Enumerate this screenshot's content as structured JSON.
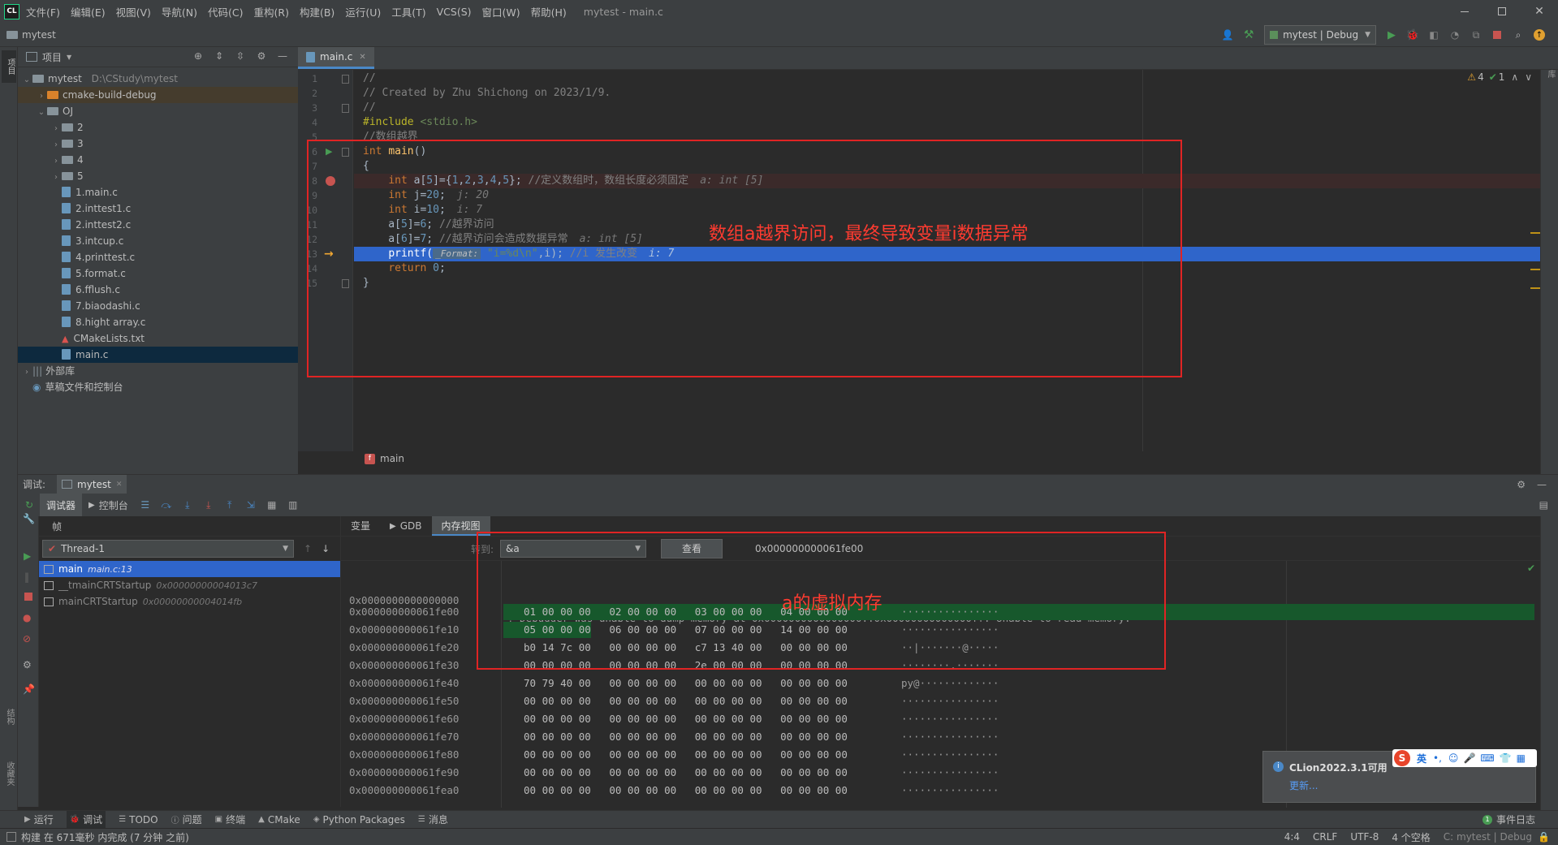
{
  "title_bar": {
    "app_logo": "CL",
    "menu": [
      "文件(F)",
      "编辑(E)",
      "视图(V)",
      "导航(N)",
      "代码(C)",
      "重构(R)",
      "构建(B)",
      "运行(U)",
      "工具(T)",
      "VCS(S)",
      "窗口(W)",
      "帮助(H)"
    ],
    "window_title": "mytest - main.c"
  },
  "nav_bar": {
    "project": "mytest",
    "run_config": "mytest | Debug"
  },
  "project_panel": {
    "title": "项目",
    "root": {
      "name": "mytest",
      "path": "D:\\CStudy\\mytest"
    },
    "items": [
      {
        "label": "cmake-build-debug",
        "kind": "folder-orange",
        "indent": 1,
        "expand": "›"
      },
      {
        "label": "OJ",
        "kind": "folder",
        "indent": 1,
        "expand": "⌄"
      },
      {
        "label": "2",
        "kind": "folder",
        "indent": 2,
        "expand": "›"
      },
      {
        "label": "3",
        "kind": "folder",
        "indent": 2,
        "expand": "›"
      },
      {
        "label": "4",
        "kind": "folder",
        "indent": 2,
        "expand": "›"
      },
      {
        "label": "5",
        "kind": "folder",
        "indent": 2,
        "expand": "›"
      },
      {
        "label": "1.main.c",
        "kind": "file",
        "indent": 2,
        "expand": ""
      },
      {
        "label": "2.inttest1.c",
        "kind": "file",
        "indent": 2,
        "expand": ""
      },
      {
        "label": "2.inttest2.c",
        "kind": "file",
        "indent": 2,
        "expand": ""
      },
      {
        "label": "3.intcup.c",
        "kind": "file",
        "indent": 2,
        "expand": ""
      },
      {
        "label": "4.printtest.c",
        "kind": "file",
        "indent": 2,
        "expand": ""
      },
      {
        "label": "5.format.c",
        "kind": "file",
        "indent": 2,
        "expand": ""
      },
      {
        "label": "6.fflush.c",
        "kind": "file",
        "indent": 2,
        "expand": ""
      },
      {
        "label": "7.biaodashi.c",
        "kind": "file",
        "indent": 2,
        "expand": ""
      },
      {
        "label": "8.hight array.c",
        "kind": "file",
        "indent": 2,
        "expand": ""
      },
      {
        "label": "CMakeLists.txt",
        "kind": "cmake",
        "indent": 2,
        "expand": ""
      },
      {
        "label": "main.c",
        "kind": "file",
        "indent": 2,
        "expand": "",
        "selected": true
      }
    ],
    "external_libs": "外部库",
    "scratches": "草稿文件和控制台"
  },
  "editor": {
    "tab": "main.c",
    "inspection": {
      "warnings": "4",
      "ok": "1"
    },
    "breadcrumb": "main",
    "lines": [
      {
        "n": "1",
        "html": "<span class='cmt'>//</span>"
      },
      {
        "n": "2",
        "html": "<span class='cmt'>// Created by Zhu Shichong on 2023/1/9.</span>"
      },
      {
        "n": "3",
        "html": "<span class='cmt'>//</span>"
      },
      {
        "n": "4",
        "html": "<span class='macro'>#include</span> <span class='str'>&lt;stdio.h&gt;</span>"
      },
      {
        "n": "5",
        "html": "<span class='cmt'>//数组越界</span>"
      },
      {
        "n": "6",
        "html": "<span class='kw'>int</span> <span class='fn'>main</span>()"
      },
      {
        "n": "7",
        "html": "{"
      },
      {
        "n": "8",
        "html": "    <span class='kw'>int</span> a[<span class='num'>5</span>]={<span class='num'>1</span>,<span class='num'>2</span>,<span class='num'>3</span>,<span class='num'>4</span>,<span class='num'>5</span>}; <span class='cmt'>//定义数组时，数组长度必须固定</span><span class='inl'>a: int [5]</span>"
      },
      {
        "n": "9",
        "html": "    <span class='kw'>int</span> j=<span class='num'>20</span>;<span class='inl'>j: 20</span>"
      },
      {
        "n": "10",
        "html": "    <span class='kw'>int</span> i=<span class='num'>10</span>;<span class='inl'>i: 7</span>"
      },
      {
        "n": "11",
        "html": "    a[<span class='num'>5</span>]=<span class='num'>6</span>; <span class='cmt'>//越界访问</span>"
      },
      {
        "n": "12",
        "html": "    a[<span class='num'>6</span>]=<span class='num'>7</span>; <span class='cmt'>//越界访问会造成数据异常</span><span class='inl'>a: int [5]</span>"
      },
      {
        "n": "13",
        "html": "    <span style='color:#ffffff'>printf(</span><span style='background:#4a6a8a;color:#c0c0c0;font-size:11px;padding:0 3px;font-style:italic'>_Format:</span> <span class='str'>\"i=%d\\n\"</span>,i); <span class='cmt'>//i 发生改变</span><span class='inl' style='color:#b0c4de'>i: 7</span>"
      },
      {
        "n": "14",
        "html": "    <span class='kw'>return</span> <span class='num'>0</span>;"
      },
      {
        "n": "15",
        "html": "}"
      }
    ],
    "annotation": "数组a越界访问，最终导致变量i数据异常"
  },
  "debug_panel": {
    "label": "调试:",
    "session_tab": "mytest",
    "tabs": [
      "调试器",
      "控制台"
    ],
    "frames_label": "帧",
    "thread": "Thread-1",
    "frames": [
      {
        "fn": "main",
        "loc": "main.c:13",
        "selected": true
      },
      {
        "fn": "__tmainCRTStartup",
        "loc": "0x00000000004013c7",
        "selected": false
      },
      {
        "fn": "mainCRTStartup",
        "loc": "0x00000000004014fb",
        "selected": false
      }
    ],
    "view_tabs": [
      "变量",
      "GDB",
      "内存视图"
    ],
    "goto_label": "转到:",
    "goto_value": "&a",
    "view_button": "查看",
    "current_address": "0x000000000061fe00",
    "error_row": {
      "addr": "0x0000000000000000",
      "msg": "! Debugger was unable to dump memory at 0x0000000000000000..0x00000000000000ff: Unable to read memory."
    },
    "annotation": "a的虚拟内存",
    "memory_rows": [
      {
        "addr": "0x000000000061fe00",
        "bytes": "01 00 00 00   02 00 00 00   03 00 00 00   04 00 00 00",
        "ascii": "················",
        "highlight": true
      },
      {
        "addr": "0x000000000061fe10",
        "bytes": "05 00 00 00   06 00 00 00   07 00 00 00   14 00 00 00",
        "ascii": "················",
        "highlight": "partial"
      },
      {
        "addr": "0x000000000061fe20",
        "bytes": "b0 14 7c 00   00 00 00 00   c7 13 40 00   00 00 00 00",
        "ascii": "··|·······@·····",
        "highlight": false
      },
      {
        "addr": "0x000000000061fe30",
        "bytes": "00 00 00 00   00 00 00 00   2e 00 00 00   00 00 00 00",
        "ascii": "········.·······",
        "highlight": false
      },
      {
        "addr": "0x000000000061fe40",
        "bytes": "70 79 40 00   00 00 00 00   00 00 00 00   00 00 00 00",
        "ascii": "py@·············",
        "highlight": false
      },
      {
        "addr": "0x000000000061fe50",
        "bytes": "00 00 00 00   00 00 00 00   00 00 00 00   00 00 00 00",
        "ascii": "················",
        "highlight": false
      },
      {
        "addr": "0x000000000061fe60",
        "bytes": "00 00 00 00   00 00 00 00   00 00 00 00   00 00 00 00",
        "ascii": "················",
        "highlight": false
      },
      {
        "addr": "0x000000000061fe70",
        "bytes": "00 00 00 00   00 00 00 00   00 00 00 00   00 00 00 00",
        "ascii": "················",
        "highlight": false
      },
      {
        "addr": "0x000000000061fe80",
        "bytes": "00 00 00 00   00 00 00 00   00 00 00 00   00 00 00 00",
        "ascii": "················",
        "highlight": false
      },
      {
        "addr": "0x000000000061fe90",
        "bytes": "00 00 00 00   00 00 00 00   00 00 00 00   00 00 00 00",
        "ascii": "················",
        "highlight": false
      },
      {
        "addr": "0x000000000061fea0",
        "bytes": "00 00 00 00   00 00 00 00   00 00 00 00   00 00 00 00",
        "ascii": "················",
        "highlight": false
      }
    ]
  },
  "notification": {
    "title": "CLion2022.3.1可用",
    "link": "更新..."
  },
  "ime_bar": {
    "logo": "S",
    "lang": "英"
  },
  "bottom_tools": [
    "运行",
    "调试",
    "TODO",
    "问题",
    "终端",
    "CMake",
    "Python Packages",
    "消息"
  ],
  "event_log": "事件日志",
  "status": {
    "message": "构建 在 671毫秒 内完成 (7 分钟 之前)",
    "position": "4:4",
    "line_sep": "CRLF",
    "encoding": "UTF-8",
    "indent": "4 个空格",
    "context": "C: mytest | Debug"
  },
  "side_labels": {
    "project": "项目",
    "structure": "结构",
    "favorites": "收藏夹",
    "db": "数据库"
  },
  "colors": {
    "accent_blue": "#2f65ca",
    "annotation_red": "#e02424",
    "run_green": "#499c54"
  }
}
